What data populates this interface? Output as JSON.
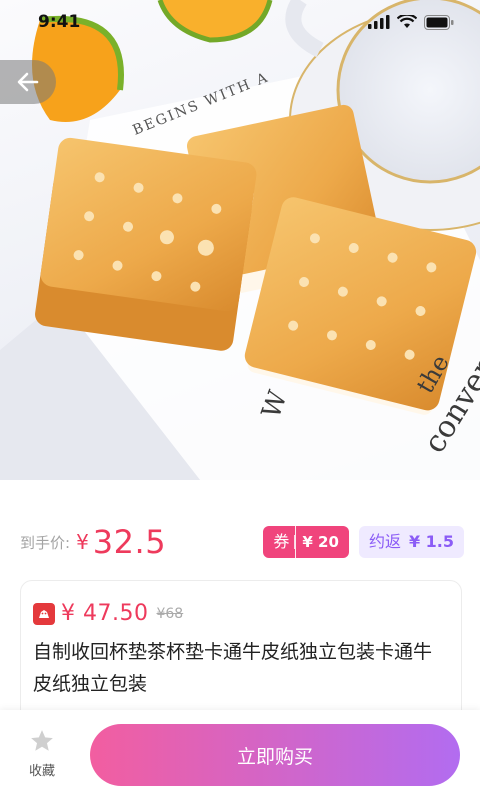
{
  "status_bar": {
    "time": "9:41"
  },
  "hero": {
    "alt_subject": "crackers product photo",
    "book_text_1": "BEGINS WITH A",
    "book_text_2": "conver",
    "book_text_3": "the",
    "book_text_4": "W"
  },
  "price": {
    "label": "到手价:",
    "currency": "¥",
    "value": "32.5",
    "coupon_tag": "券",
    "coupon_amount": "¥ 20",
    "rebate_label": "约返",
    "rebate_amount": "¥ 1.5"
  },
  "product": {
    "store_icon_label": "京东",
    "price": "¥ 47.50",
    "original_price": "¥68",
    "title": "自制收回杯垫茶杯垫卡通牛皮纸独立包装卡通牛皮纸独立包装"
  },
  "bottom_bar": {
    "favorite_label": "收藏",
    "buy_label": "立即购买"
  },
  "colors": {
    "accent_red": "#ee3a5c",
    "coupon_pink": "#f0447c",
    "rebate_purple": "#8b5cf6",
    "buy_gradient_start": "#f25ea0",
    "buy_gradient_end": "#b26cf0"
  }
}
